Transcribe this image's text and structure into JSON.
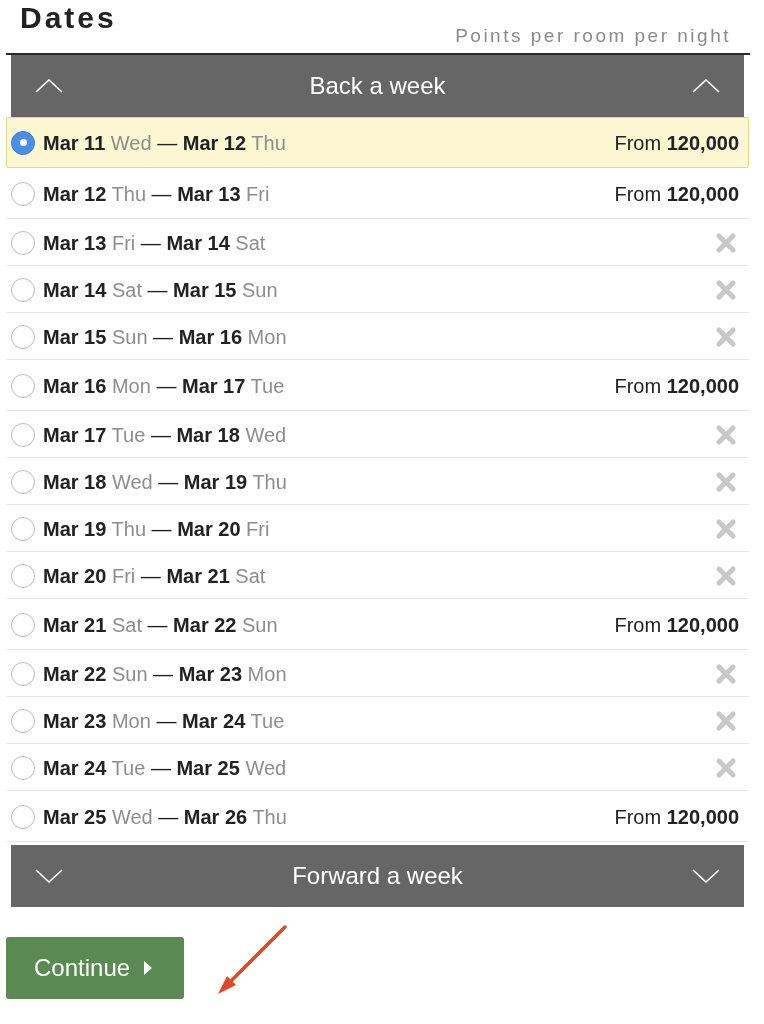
{
  "header": {
    "title": "Dates",
    "subtitle": "Points per room per night"
  },
  "back_bar": {
    "label": "Back a week"
  },
  "rows": [
    {
      "kind": "price",
      "selected": true,
      "check_in": {
        "date": "Mar 11",
        "day": "Wed"
      },
      "separator": "—",
      "check_out": {
        "date": "Mar 12",
        "day": "Thu"
      },
      "price": "From **120,000**"
    },
    {
      "kind": "price",
      "selected": false,
      "check_in": {
        "date": "Mar 12",
        "day": "Thu"
      },
      "separator": "—",
      "check_out": {
        "date": "Mar 13",
        "day": "Fri"
      },
      "price": "From **120,000**"
    },
    {
      "kind": "unavailable",
      "selected": false,
      "check_in": {
        "date": "Mar 13",
        "day": "Fri"
      },
      "separator": "—",
      "check_out": {
        "date": "Mar 14",
        "day": "Sat"
      }
    },
    {
      "kind": "unavailable",
      "selected": false,
      "check_in": {
        "date": "Mar 14",
        "day": "Sat"
      },
      "separator": "—",
      "check_out": {
        "date": "Mar 15",
        "day": "Sun"
      }
    },
    {
      "kind": "unavailable",
      "selected": false,
      "check_in": {
        "date": "Mar 15",
        "day": "Sun"
      },
      "separator": "—",
      "check_out": {
        "date": "Mar 16",
        "day": "Mon"
      }
    },
    {
      "kind": "price",
      "selected": false,
      "check_in": {
        "date": "Mar 16",
        "day": "Mon"
      },
      "separator": "—",
      "check_out": {
        "date": "Mar 17",
        "day": "Tue"
      },
      "price": "From **120,000**"
    },
    {
      "kind": "unavailable",
      "selected": false,
      "check_in": {
        "date": "Mar 17",
        "day": "Tue"
      },
      "separator": "—",
      "check_out": {
        "date": "Mar 18",
        "day": "Wed"
      }
    },
    {
      "kind": "unavailable",
      "selected": false,
      "check_in": {
        "date": "Mar 18",
        "day": "Wed"
      },
      "separator": "—",
      "check_out": {
        "date": "Mar 19",
        "day": "Thu"
      }
    },
    {
      "kind": "unavailable",
      "selected": false,
      "check_in": {
        "date": "Mar 19",
        "day": "Thu"
      },
      "separator": "—",
      "check_out": {
        "date": "Mar 20",
        "day": "Fri"
      }
    },
    {
      "kind": "unavailable",
      "selected": false,
      "check_in": {
        "date": "Mar 20",
        "day": "Fri"
      },
      "separator": "—",
      "check_out": {
        "date": "Mar 21",
        "day": "Sat"
      }
    },
    {
      "kind": "price",
      "selected": false,
      "check_in": {
        "date": "Mar 21",
        "day": "Sat"
      },
      "separator": "—",
      "check_out": {
        "date": "Mar 22",
        "day": "Sun"
      },
      "price": "From **120,000**"
    },
    {
      "kind": "unavailable",
      "selected": false,
      "check_in": {
        "date": "Mar 22",
        "day": "Sun"
      },
      "separator": "—",
      "check_out": {
        "date": "Mar 23",
        "day": "Mon"
      }
    },
    {
      "kind": "unavailable",
      "selected": false,
      "check_in": {
        "date": "Mar 23",
        "day": "Mon"
      },
      "separator": "—",
      "check_out": {
        "date": "Mar 24",
        "day": "Tue"
      }
    },
    {
      "kind": "unavailable",
      "selected": false,
      "check_in": {
        "date": "Mar 24",
        "day": "Tue"
      },
      "separator": "—",
      "check_out": {
        "date": "Mar 25",
        "day": "Wed"
      }
    },
    {
      "kind": "price",
      "selected": false,
      "check_in": {
        "date": "Mar 25",
        "day": "Wed"
      },
      "separator": "—",
      "check_out": {
        "date": "Mar 26",
        "day": "Thu"
      },
      "price": "From **120,000**"
    }
  ],
  "forward_bar": {
    "label": "Forward a week"
  },
  "continue_button": {
    "label": "Continue"
  }
}
